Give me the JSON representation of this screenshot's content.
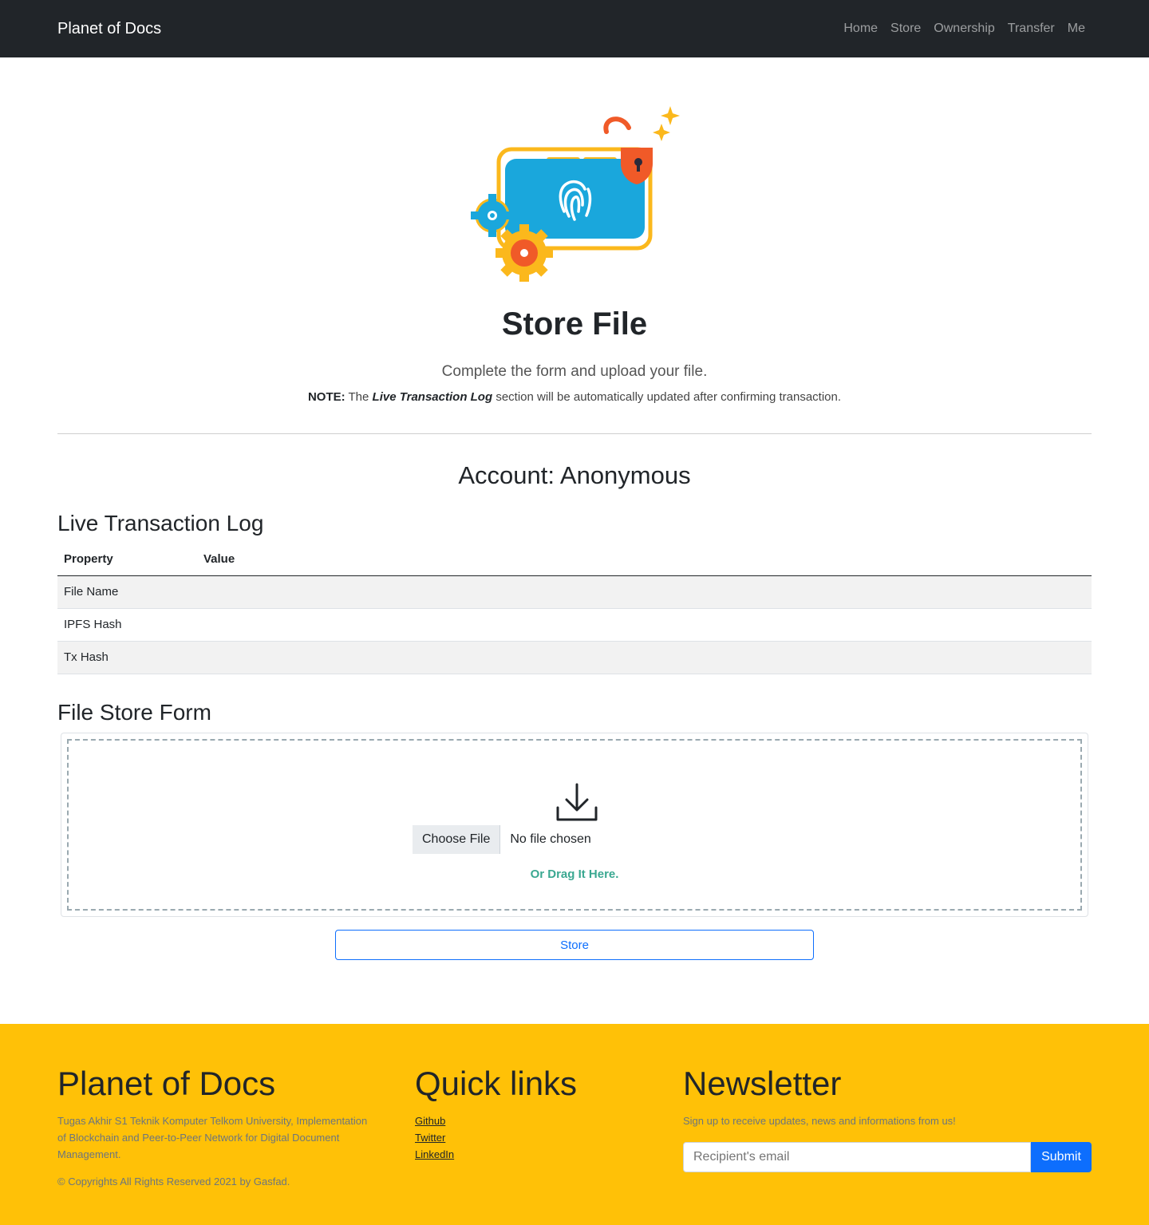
{
  "nav": {
    "brand": "Planet of Docs",
    "links": [
      "Home",
      "Store",
      "Ownership",
      "Transfer",
      "Me"
    ]
  },
  "hero": {
    "title": "Store File",
    "lead": "Complete the form and upload your file.",
    "note_label": "NOTE:",
    "note_pre": "The",
    "note_emph": "Live Transaction Log",
    "note_post": "section will be automatically updated after confirming transaction."
  },
  "account": {
    "label": "Account: Anonymous"
  },
  "log": {
    "heading": "Live Transaction Log",
    "headers": [
      "Property",
      "Value"
    ],
    "rows": [
      {
        "property": "File Name",
        "value": ""
      },
      {
        "property": "IPFS Hash",
        "value": ""
      },
      {
        "property": "Tx Hash",
        "value": ""
      }
    ]
  },
  "form": {
    "heading": "File Store Form",
    "choose_label": "Choose File",
    "file_status": "No file chosen",
    "drag_text": "Or Drag It Here.",
    "store_label": "Store"
  },
  "footer": {
    "brand": "Planet of Docs",
    "description": "Tugas Akhir S1 Teknik Komputer Telkom University, Implementation of Blockchain and Peer-to-Peer Network for Digital Document Management.",
    "copyright": "© Copyrights All Rights Reserved 2021 by Gasfad.",
    "quick_title": "Quick links",
    "links": [
      "Github",
      "Twitter",
      "LinkedIn"
    ],
    "news_title": "Newsletter",
    "news_text": "Sign up to receive updates, news and informations from us!",
    "email_placeholder": "Recipient's email",
    "submit_label": "Submit"
  },
  "colors": {
    "navbar": "#212529",
    "footer": "#ffc107",
    "primary": "#0d6efd",
    "drag_text": "#3aa891"
  }
}
